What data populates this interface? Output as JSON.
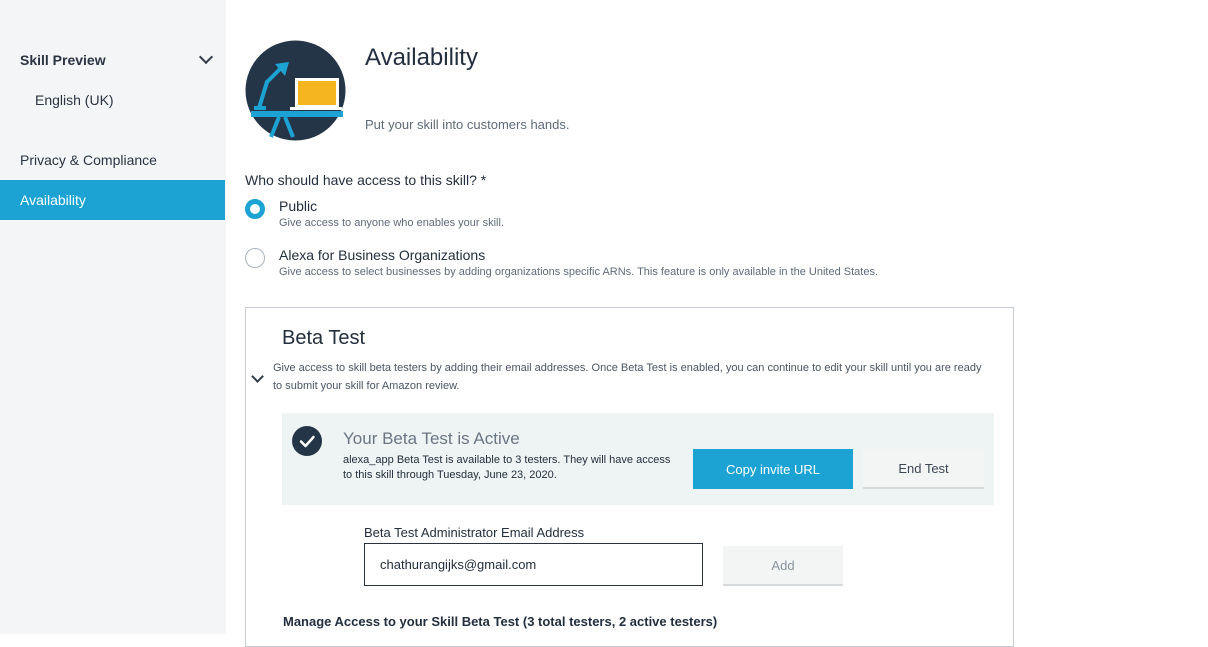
{
  "sidebar": {
    "items": [
      {
        "label": "Skill Preview"
      },
      {
        "label": "English (UK)"
      },
      {
        "label": "Privacy & Compliance"
      },
      {
        "label": "Availability"
      }
    ]
  },
  "header": {
    "title": "Availability",
    "subtitle": "Put your skill into customers hands."
  },
  "access": {
    "question": "Who should have access to this skill? *",
    "options": [
      {
        "label": "Public",
        "description": "Give access to anyone who enables your skill.",
        "selected": true
      },
      {
        "label": "Alexa for Business Organizations",
        "description": "Give access to select businesses by adding organizations specific ARNs. This feature is only available in the United States.",
        "selected": false
      }
    ]
  },
  "beta": {
    "title": "Beta Test",
    "description": "Give access to skill beta testers by adding their email addresses. Once Beta Test is enabled, you can continue to edit your skill until you are ready to submit your skill for Amazon review.",
    "status_title": "Your Beta Test is Active",
    "status_desc": "alexa_app Beta Test is available to 3 testers. They will have access to this skill through Tuesday, June 23, 2020.",
    "copy_button": "Copy invite URL",
    "end_button": "End Test",
    "email_label": "Beta Test Administrator Email Address",
    "email_value": "chathurangijks@gmail.com",
    "add_button": "Add",
    "manage_title": "Manage Access to your Skill Beta Test (3 total testers, 2 active testers)"
  },
  "colors": {
    "accent": "#1ca3d4",
    "sidebar_bg": "#f3f5f7",
    "panel_bg": "#eef3f3",
    "text": "#232f3e"
  },
  "icons": {
    "hero": "desk-lamp-laptop-icon",
    "chevron": "chevron-down-icon",
    "check": "checkmark-icon"
  }
}
